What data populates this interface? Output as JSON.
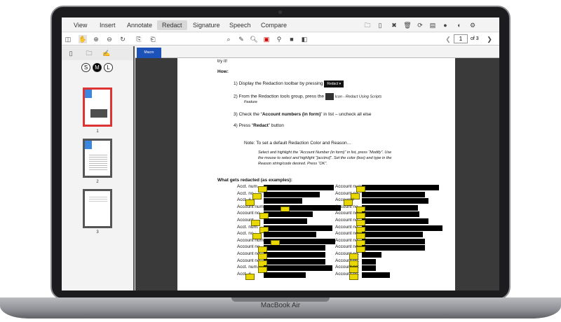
{
  "device": {
    "label": "MacBook Air"
  },
  "menu": [
    "View",
    "Insert",
    "Annotate",
    "Redact",
    "Signature",
    "Speech",
    "Compare"
  ],
  "active_menu": "Redact",
  "menu_icons": [
    "open-folder-icon",
    "new-file-icon",
    "close-doc-icon",
    "delete-icon",
    "sync-icon",
    "comment-icon",
    "info-icon",
    "text-to-speech-icon",
    "settings-icon"
  ],
  "toolbar": {
    "page_current": "1",
    "page_total": "of 3",
    "prev": "❮",
    "next": "❯"
  },
  "sidebar": {
    "sizes": [
      "S",
      "M",
      "L"
    ],
    "thumbs": [
      "1",
      "2",
      "3"
    ]
  },
  "tab": {
    "label": "Macro"
  },
  "doc": {
    "try": "try it!",
    "how": "How:",
    "s1": "1)  Display the Redaction toolbar by pressing",
    "redact_btn": "Redact ▾",
    "s2": "2)  From the Redaction tools group, press the",
    "s2b": "Icon  - Redact Using Scripts",
    "s2c": "Feature",
    "s3a": "3)  Check the “",
    "s3b": "Account numbers (in form)",
    "s3c": "” in list – uncheck all else",
    "s4a": "4)  Press “",
    "s4b": "Redact",
    "s4c": "” button",
    "note": "Note: To set a default Redaction Color and Reason…",
    "n1": "Select and highlight the “Account Number (in form)” in list, press “Modify”.  Use",
    "n2": "the mouse to select and highlight “[acctno]”.  Set the color (box) and type in the",
    "n3": "Reason string/code desired.  Press “OK”.",
    "what": "What gets redacted (as examples):",
    "left": [
      "Acct. num.",
      "Acct. no.:",
      "Acct. #",
      "Account number",
      "Account no.",
      "Account",
      "Acct. num.",
      "Acct. no.:",
      "Account num.",
      "Account no.",
      "Account no.",
      "Account no.",
      "Acct. num.",
      "Acct. #"
    ],
    "right": [
      "Account num.",
      "Account no.",
      "Account#",
      "Account no.",
      "Account no.",
      "Account no.",
      "Account no.",
      "Account no.",
      "Account no.",
      "Account no.",
      "Account no:",
      "Account no:",
      "Account no:",
      "Account no:"
    ]
  }
}
